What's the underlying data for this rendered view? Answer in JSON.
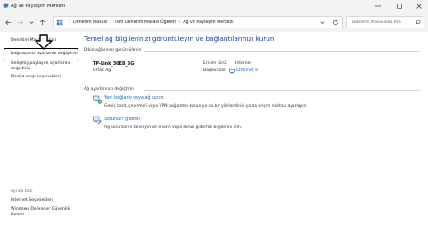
{
  "window": {
    "title": "Ağ ve Paylaşım Merkezi"
  },
  "address": {
    "crumbs": [
      "Denetim Masası",
      "Tüm Denetim Masası Öğeleri",
      "Ağ ve Paylaşım Merkezi"
    ]
  },
  "search": {
    "placeholder": "Denetim Masasında Ara"
  },
  "sidebar": {
    "home": "Denetim Masası Girişi",
    "adapter": "Bağdaştırıcı ayarlarını değiştirin",
    "sharing_line1": "Gelişmiş paylaşım ayarlarını",
    "sharing_line2": "değiştirin",
    "media": "Medya akışı seçenekleri",
    "see_also": "Ayrıca bkz.",
    "internet_options": "Internet Seçenekleri",
    "defender_line1": "Windows Defender Güvenlik",
    "defender_line2": "Duvarı"
  },
  "main": {
    "title": "Temel ağ bilgilerinizi görüntüleyin ve bağlantılarınızı kurun",
    "active_networks": "Etkin ağlarınızı görüntüleyin",
    "network_name": "TP-Link_30E8_5G",
    "network_type": "Ortak Ağ",
    "access_type_label": "Erişim türü:",
    "access_type_value": "Internet",
    "connections_label": "Bağlantılar:",
    "connections_value": "Ethernet 6",
    "change_settings": "Ağ ayarlarınızı değiştirin",
    "task1_title": "Yeni bağlantı veya ağ kurun",
    "task1_desc": "Geniş bant, çevirmeli veya VPN bağlantısı kurun ya da bir yönlendirici ya da erişim noktası ayarlayın.",
    "task2_title": "Sorunları giderin",
    "task2_desc": "Ağ sorunlarını tanılayın ve onarın veya sorun giderme bilgilerini alın."
  },
  "colors": {
    "link": "#1464b4",
    "title": "#1e3d8f",
    "highlight_border": "#000000"
  }
}
